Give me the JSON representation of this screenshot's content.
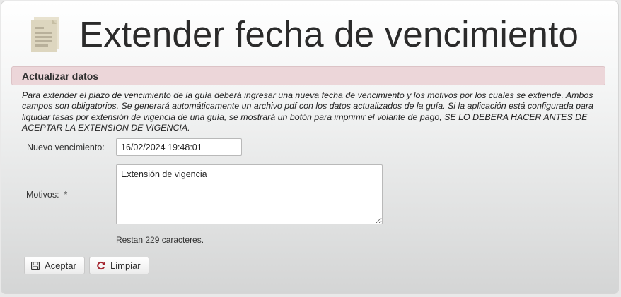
{
  "page": {
    "title": "Extender fecha de vencimiento",
    "icon": "document-icon"
  },
  "section": {
    "title": "Actualizar datos",
    "description": "Para extender el plazo de vencimiento de la guía deberá ingresar una nueva fecha de vencimiento y los motivos por los cuales se extiende. Ambos campos son obligatorios. Se generará automáticamente un archivo pdf con los datos actualizados de la guía. Si la aplicación está configurada para liquidar tasas por extensión de vigencia de una guía, se mostrará un botón para imprimir el volante de pago, SE LO DEBERA HACER ANTES DE ACEPTAR LA EXTENSION DE VIGENCIA."
  },
  "form": {
    "nuevo_vencimiento_label": "Nuevo vencimiento:",
    "nuevo_vencimiento_value": "16/02/2024 19:48:01",
    "motivos_label": "Motivos:  *",
    "motivos_value": "Extensión de vigencia",
    "counter_text": "Restan 229 caracteres."
  },
  "buttons": {
    "accept_label": "Aceptar",
    "accept_icon": "save-icon",
    "clear_label": "Limpiar",
    "clear_icon": "refresh-icon"
  },
  "colors": {
    "section_bar": "#ecd6d9",
    "refresh_icon": "#a3232d"
  }
}
